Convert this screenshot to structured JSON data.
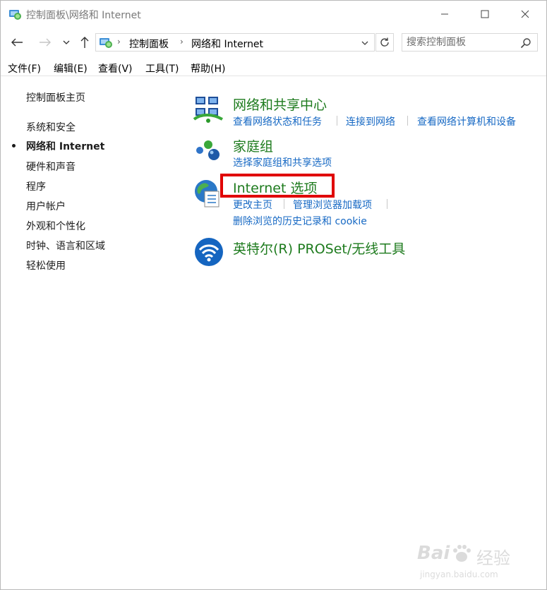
{
  "window": {
    "title": "控制面板\\网络和 Internet"
  },
  "navigation": {
    "breadcrumbs": [
      "控制面板",
      "网络和 Internet"
    ],
    "search_placeholder": "搜索控制面板"
  },
  "menubar": {
    "items": [
      "文件(F)",
      "编辑(E)",
      "查看(V)",
      "工具(T)",
      "帮助(H)"
    ]
  },
  "sidebar": {
    "home": "控制面板主页",
    "items": [
      "系统和安全",
      "网络和 Internet",
      "硬件和声音",
      "程序",
      "用户帐户",
      "外观和个性化",
      "时钟、语言和区域",
      "轻松使用"
    ],
    "current_index": 1
  },
  "categories": [
    {
      "title": "网络和共享中心",
      "icon": "network-sharing-icon",
      "tasks": [
        "查看网络状态和任务",
        "连接到网络",
        "查看网络计算机和设备"
      ]
    },
    {
      "title": "家庭组",
      "icon": "homegroup-icon",
      "tasks": [
        "选择家庭组和共享选项"
      ]
    },
    {
      "title": "Internet 选项",
      "icon": "internet-options-icon",
      "tasks": [
        "更改主页",
        "管理浏览器加载项",
        "删除浏览的历史记录和 cookie"
      ],
      "highlighted": true
    },
    {
      "title": "英特尔(R) PROSet/无线工具",
      "icon": "wireless-icon",
      "tasks": []
    }
  ],
  "watermark": {
    "brand": "Bai",
    "brand_cn": "经验",
    "url": "jingyan.baidu.com"
  },
  "colors": {
    "category_title": "#1e7b1e",
    "task_link": "#1769c4",
    "highlight": "#e00000"
  }
}
